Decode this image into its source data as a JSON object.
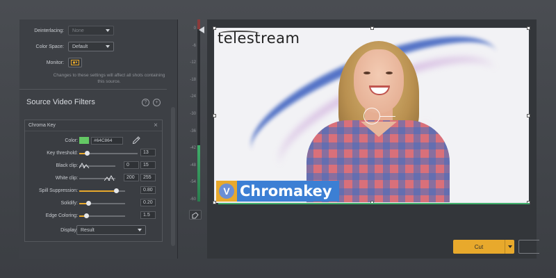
{
  "settings": {
    "deinterlacing_label": "Deinterlacing:",
    "deinterlacing_value": "None",
    "color_space_label": "Color Space:",
    "color_space_value": "Default",
    "monitor_label": "Monitor:",
    "note": "Changes to these settings will affect all shots containing this source."
  },
  "filters": {
    "section_title": "Source Video Filters",
    "help_glyph": "?",
    "add_glyph": "+",
    "chroma_key": {
      "title": "Chroma Key",
      "close_glyph": "×",
      "color_label": "Color:",
      "color_hex": "#64C864",
      "key_threshold_label": "Key threshold:",
      "key_threshold_value": "13",
      "key_threshold_level": 0.13,
      "black_clip_label": "Black clip:",
      "black_clip_low": "0",
      "black_clip_high": "15",
      "white_clip_label": "White clip:",
      "white_clip_low": "200",
      "white_clip_high": "255",
      "spill_label": "Spill Suppression:",
      "spill_value": "0.80",
      "spill_level": 0.8,
      "solidify_label": "Solidify:",
      "solidify_value": "0.20",
      "solidify_level": 0.2,
      "edge_label": "Edge Coloring:",
      "edge_value": "1.5",
      "edge_level": 0.15,
      "display_label": "Display:",
      "display_value": "Result"
    }
  },
  "meter": {
    "labels": [
      "0",
      "-6",
      "-12",
      "-18",
      "-24",
      "-30",
      "-36",
      "-42",
      "-48",
      "-54",
      "-60"
    ],
    "level": 0.32
  },
  "preview": {
    "brand_text": "telestream",
    "lower_third_logo": "V",
    "lower_third_text": "Chromakey"
  },
  "actions": {
    "cut_label": "Cut"
  },
  "colors": {
    "accent": "#e8a92c",
    "key_color": "#64C864",
    "lower_third_blue": "#3c7fd4"
  }
}
